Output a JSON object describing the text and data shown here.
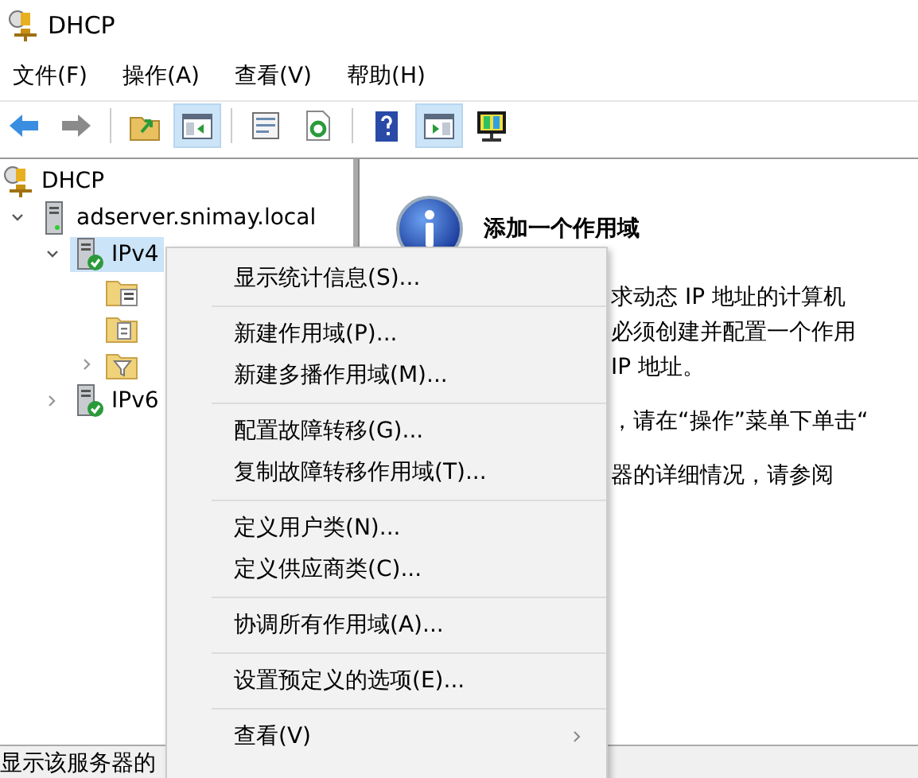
{
  "window": {
    "title": "DHCP"
  },
  "menu_bar": [
    "文件(F)",
    "操作(A)",
    "查看(V)",
    "帮助(H)"
  ],
  "toolbar": [
    {
      "kind": "back",
      "on": false
    },
    {
      "kind": "forward",
      "on": false
    },
    {
      "kind": "sep"
    },
    {
      "kind": "up",
      "on": false
    },
    {
      "kind": "tree",
      "on": true
    },
    {
      "kind": "sep"
    },
    {
      "kind": "props",
      "on": false
    },
    {
      "kind": "refresh",
      "on": false
    },
    {
      "kind": "sep"
    },
    {
      "kind": "help",
      "on": false
    },
    {
      "kind": "actions",
      "on": true
    },
    {
      "kind": "monitor",
      "on": false
    }
  ],
  "tree": [
    {
      "label": "DHCP",
      "kind": "root",
      "selected": false,
      "children": [
        {
          "label": "adserver.snimay.local",
          "kind": "server",
          "expanded": true,
          "selected": false,
          "children": [
            {
              "label": "IPv4",
              "kind": "protocol",
              "expanded": true,
              "selected": true,
              "children": [
                {
                  "kind": "folder-list"
                },
                {
                  "kind": "folder-page"
                },
                {
                  "kind": "folder-filter",
                  "expanded": false
                }
              ]
            },
            {
              "label": "IPv6",
              "kind": "protocol",
              "expanded": false,
              "selected": false
            }
          ]
        }
      ]
    }
  ],
  "info_pane": {
    "heading": "添加一个作用域",
    "paragraphs": [
      [
        "求动态 IP 地址的计算机",
        "必须创建并配置一个作用",
        "IP 地址。"
      ],
      [
        "，请在“操作”菜单下单击“"
      ],
      [
        "器的详细情况，请参阅"
      ]
    ]
  },
  "context_menu": [
    {
      "kind": "item",
      "label": "显示统计信息(S)..."
    },
    {
      "kind": "separator"
    },
    {
      "kind": "item",
      "label": "新建作用域(P)..."
    },
    {
      "kind": "item",
      "label": "新建多播作用域(M)..."
    },
    {
      "kind": "separator"
    },
    {
      "kind": "item",
      "label": "配置故障转移(G)..."
    },
    {
      "kind": "item",
      "label": "复制故障转移作用域(T)..."
    },
    {
      "kind": "separator"
    },
    {
      "kind": "item",
      "label": "定义用户类(N)..."
    },
    {
      "kind": "item",
      "label": "定义供应商类(C)..."
    },
    {
      "kind": "separator"
    },
    {
      "kind": "item",
      "label": "协调所有作用域(A)..."
    },
    {
      "kind": "separator"
    },
    {
      "kind": "item",
      "label": "设置预定义的选项(E)..."
    },
    {
      "kind": "separator"
    },
    {
      "kind": "submenu",
      "label": "查看(V)"
    }
  ],
  "status_bar": "显示该服务器的"
}
